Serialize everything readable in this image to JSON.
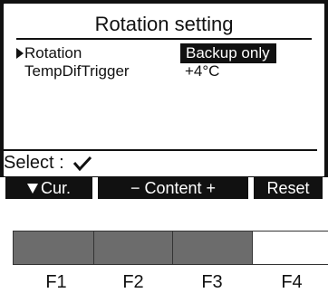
{
  "screen": {
    "title": "Rotation setting",
    "rows": [
      {
        "label": "Rotation",
        "value": "Backup only",
        "selected": true
      },
      {
        "label": "TempDifTrigger",
        "value": "+4°C",
        "selected": false
      }
    ],
    "select_label": "Select :",
    "softkeys": {
      "f1": "Cur.",
      "f2": "− Content +",
      "f3": "Reset"
    }
  },
  "hardware_keys": [
    "F1",
    "F2",
    "F3",
    "F4"
  ],
  "colors": {
    "lcd_background": "#ffffff",
    "frame": "#111111",
    "key_gray": "#6c6c6c"
  }
}
